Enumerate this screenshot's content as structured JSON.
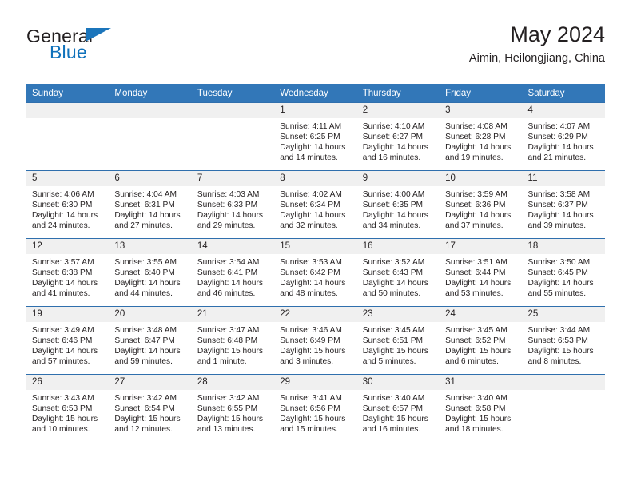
{
  "logo": {
    "word1": "General",
    "word2": "Blue",
    "flag_icon": "blue-triangle-flag-icon",
    "accent_color": "#1072bb"
  },
  "header": {
    "month_title": "May 2024",
    "location": "Aimin, Heilongjiang, China"
  },
  "theme": {
    "header_blue": "#3277b8",
    "row_divider_blue": "#2f6fad",
    "daynum_band": "#f0f0f0"
  },
  "calendar": {
    "weekday_headers": [
      "Sunday",
      "Monday",
      "Tuesday",
      "Wednesday",
      "Thursday",
      "Friday",
      "Saturday"
    ],
    "weeks": [
      [
        {
          "day": "",
          "sunrise": "",
          "sunset": "",
          "daylight1": "",
          "daylight2": ""
        },
        {
          "day": "",
          "sunrise": "",
          "sunset": "",
          "daylight1": "",
          "daylight2": ""
        },
        {
          "day": "",
          "sunrise": "",
          "sunset": "",
          "daylight1": "",
          "daylight2": ""
        },
        {
          "day": "1",
          "sunrise": "Sunrise: 4:11 AM",
          "sunset": "Sunset: 6:25 PM",
          "daylight1": "Daylight: 14 hours",
          "daylight2": "and 14 minutes."
        },
        {
          "day": "2",
          "sunrise": "Sunrise: 4:10 AM",
          "sunset": "Sunset: 6:27 PM",
          "daylight1": "Daylight: 14 hours",
          "daylight2": "and 16 minutes."
        },
        {
          "day": "3",
          "sunrise": "Sunrise: 4:08 AM",
          "sunset": "Sunset: 6:28 PM",
          "daylight1": "Daylight: 14 hours",
          "daylight2": "and 19 minutes."
        },
        {
          "day": "4",
          "sunrise": "Sunrise: 4:07 AM",
          "sunset": "Sunset: 6:29 PM",
          "daylight1": "Daylight: 14 hours",
          "daylight2": "and 21 minutes."
        }
      ],
      [
        {
          "day": "5",
          "sunrise": "Sunrise: 4:06 AM",
          "sunset": "Sunset: 6:30 PM",
          "daylight1": "Daylight: 14 hours",
          "daylight2": "and 24 minutes."
        },
        {
          "day": "6",
          "sunrise": "Sunrise: 4:04 AM",
          "sunset": "Sunset: 6:31 PM",
          "daylight1": "Daylight: 14 hours",
          "daylight2": "and 27 minutes."
        },
        {
          "day": "7",
          "sunrise": "Sunrise: 4:03 AM",
          "sunset": "Sunset: 6:33 PM",
          "daylight1": "Daylight: 14 hours",
          "daylight2": "and 29 minutes."
        },
        {
          "day": "8",
          "sunrise": "Sunrise: 4:02 AM",
          "sunset": "Sunset: 6:34 PM",
          "daylight1": "Daylight: 14 hours",
          "daylight2": "and 32 minutes."
        },
        {
          "day": "9",
          "sunrise": "Sunrise: 4:00 AM",
          "sunset": "Sunset: 6:35 PM",
          "daylight1": "Daylight: 14 hours",
          "daylight2": "and 34 minutes."
        },
        {
          "day": "10",
          "sunrise": "Sunrise: 3:59 AM",
          "sunset": "Sunset: 6:36 PM",
          "daylight1": "Daylight: 14 hours",
          "daylight2": "and 37 minutes."
        },
        {
          "day": "11",
          "sunrise": "Sunrise: 3:58 AM",
          "sunset": "Sunset: 6:37 PM",
          "daylight1": "Daylight: 14 hours",
          "daylight2": "and 39 minutes."
        }
      ],
      [
        {
          "day": "12",
          "sunrise": "Sunrise: 3:57 AM",
          "sunset": "Sunset: 6:38 PM",
          "daylight1": "Daylight: 14 hours",
          "daylight2": "and 41 minutes."
        },
        {
          "day": "13",
          "sunrise": "Sunrise: 3:55 AM",
          "sunset": "Sunset: 6:40 PM",
          "daylight1": "Daylight: 14 hours",
          "daylight2": "and 44 minutes."
        },
        {
          "day": "14",
          "sunrise": "Sunrise: 3:54 AM",
          "sunset": "Sunset: 6:41 PM",
          "daylight1": "Daylight: 14 hours",
          "daylight2": "and 46 minutes."
        },
        {
          "day": "15",
          "sunrise": "Sunrise: 3:53 AM",
          "sunset": "Sunset: 6:42 PM",
          "daylight1": "Daylight: 14 hours",
          "daylight2": "and 48 minutes."
        },
        {
          "day": "16",
          "sunrise": "Sunrise: 3:52 AM",
          "sunset": "Sunset: 6:43 PM",
          "daylight1": "Daylight: 14 hours",
          "daylight2": "and 50 minutes."
        },
        {
          "day": "17",
          "sunrise": "Sunrise: 3:51 AM",
          "sunset": "Sunset: 6:44 PM",
          "daylight1": "Daylight: 14 hours",
          "daylight2": "and 53 minutes."
        },
        {
          "day": "18",
          "sunrise": "Sunrise: 3:50 AM",
          "sunset": "Sunset: 6:45 PM",
          "daylight1": "Daylight: 14 hours",
          "daylight2": "and 55 minutes."
        }
      ],
      [
        {
          "day": "19",
          "sunrise": "Sunrise: 3:49 AM",
          "sunset": "Sunset: 6:46 PM",
          "daylight1": "Daylight: 14 hours",
          "daylight2": "and 57 minutes."
        },
        {
          "day": "20",
          "sunrise": "Sunrise: 3:48 AM",
          "sunset": "Sunset: 6:47 PM",
          "daylight1": "Daylight: 14 hours",
          "daylight2": "and 59 minutes."
        },
        {
          "day": "21",
          "sunrise": "Sunrise: 3:47 AM",
          "sunset": "Sunset: 6:48 PM",
          "daylight1": "Daylight: 15 hours",
          "daylight2": "and 1 minute."
        },
        {
          "day": "22",
          "sunrise": "Sunrise: 3:46 AM",
          "sunset": "Sunset: 6:49 PM",
          "daylight1": "Daylight: 15 hours",
          "daylight2": "and 3 minutes."
        },
        {
          "day": "23",
          "sunrise": "Sunrise: 3:45 AM",
          "sunset": "Sunset: 6:51 PM",
          "daylight1": "Daylight: 15 hours",
          "daylight2": "and 5 minutes."
        },
        {
          "day": "24",
          "sunrise": "Sunrise: 3:45 AM",
          "sunset": "Sunset: 6:52 PM",
          "daylight1": "Daylight: 15 hours",
          "daylight2": "and 6 minutes."
        },
        {
          "day": "25",
          "sunrise": "Sunrise: 3:44 AM",
          "sunset": "Sunset: 6:53 PM",
          "daylight1": "Daylight: 15 hours",
          "daylight2": "and 8 minutes."
        }
      ],
      [
        {
          "day": "26",
          "sunrise": "Sunrise: 3:43 AM",
          "sunset": "Sunset: 6:53 PM",
          "daylight1": "Daylight: 15 hours",
          "daylight2": "and 10 minutes."
        },
        {
          "day": "27",
          "sunrise": "Sunrise: 3:42 AM",
          "sunset": "Sunset: 6:54 PM",
          "daylight1": "Daylight: 15 hours",
          "daylight2": "and 12 minutes."
        },
        {
          "day": "28",
          "sunrise": "Sunrise: 3:42 AM",
          "sunset": "Sunset: 6:55 PM",
          "daylight1": "Daylight: 15 hours",
          "daylight2": "and 13 minutes."
        },
        {
          "day": "29",
          "sunrise": "Sunrise: 3:41 AM",
          "sunset": "Sunset: 6:56 PM",
          "daylight1": "Daylight: 15 hours",
          "daylight2": "and 15 minutes."
        },
        {
          "day": "30",
          "sunrise": "Sunrise: 3:40 AM",
          "sunset": "Sunset: 6:57 PM",
          "daylight1": "Daylight: 15 hours",
          "daylight2": "and 16 minutes."
        },
        {
          "day": "31",
          "sunrise": "Sunrise: 3:40 AM",
          "sunset": "Sunset: 6:58 PM",
          "daylight1": "Daylight: 15 hours",
          "daylight2": "and 18 minutes."
        },
        {
          "day": "",
          "sunrise": "",
          "sunset": "",
          "daylight1": "",
          "daylight2": ""
        }
      ]
    ]
  }
}
